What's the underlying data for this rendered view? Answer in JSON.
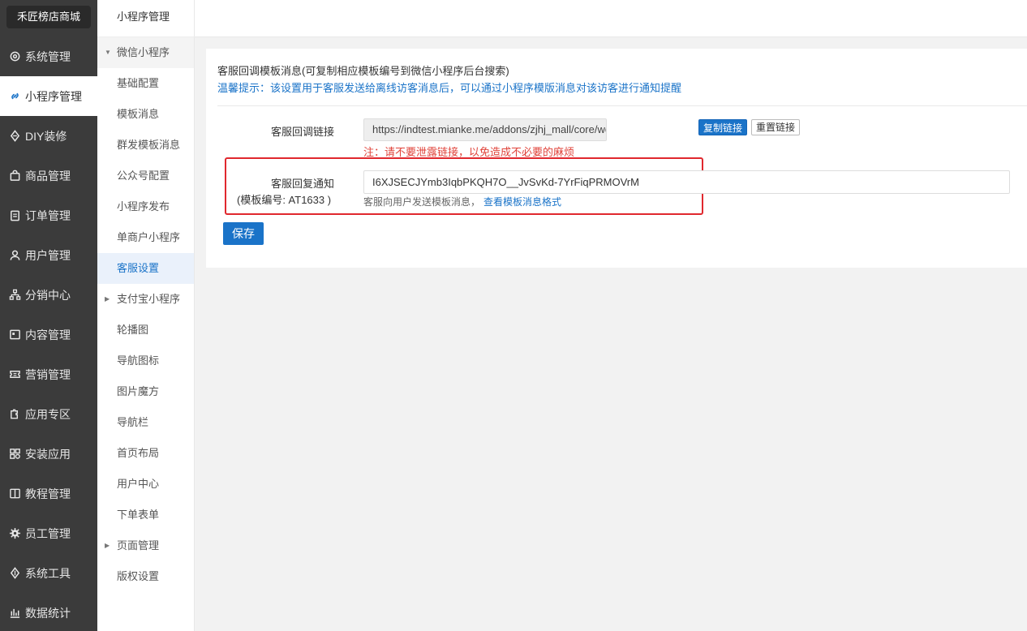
{
  "brand": "禾匠榜店商城",
  "sidebar": {
    "items": [
      {
        "label": "系统管理",
        "icon": "gear-icon"
      },
      {
        "label": "小程序管理",
        "icon": "link-icon",
        "active": true
      },
      {
        "label": "DIY装修",
        "icon": "diamond-icon"
      },
      {
        "label": "商品管理",
        "icon": "bag-icon"
      },
      {
        "label": "订单管理",
        "icon": "clipboard-icon"
      },
      {
        "label": "用户管理",
        "icon": "user-icon"
      },
      {
        "label": "分销中心",
        "icon": "tree-icon"
      },
      {
        "label": "内容管理",
        "icon": "document-icon"
      },
      {
        "label": "营销管理",
        "icon": "ticket-icon"
      },
      {
        "label": "应用专区",
        "icon": "puzzle-icon"
      },
      {
        "label": "安装应用",
        "icon": "grid-icon"
      },
      {
        "label": "教程管理",
        "icon": "book-icon"
      },
      {
        "label": "员工管理",
        "icon": "cog-icon"
      },
      {
        "label": "系统工具",
        "icon": "tool-icon"
      },
      {
        "label": "数据统计",
        "icon": "chart-icon"
      }
    ]
  },
  "subnav": {
    "title": "小程序管理",
    "items": [
      {
        "label": "微信小程序",
        "type": "group",
        "expanded": true
      },
      {
        "label": "基础配置"
      },
      {
        "label": "模板消息"
      },
      {
        "label": "群发模板消息"
      },
      {
        "label": "公众号配置"
      },
      {
        "label": "小程序发布"
      },
      {
        "label": "单商户小程序"
      },
      {
        "label": "客服设置",
        "active": true
      },
      {
        "label": "支付宝小程序",
        "type": "group",
        "expanded": false
      },
      {
        "label": "轮播图"
      },
      {
        "label": "导航图标"
      },
      {
        "label": "图片魔方"
      },
      {
        "label": "导航栏"
      },
      {
        "label": "首页布局"
      },
      {
        "label": "用户中心"
      },
      {
        "label": "下单表单"
      },
      {
        "label": "页面管理",
        "type": "group",
        "expanded": false
      },
      {
        "label": "版权设置"
      }
    ]
  },
  "main": {
    "title": "客服回调模板消息(可复制相应模板编号到微信小程序后台搜索)",
    "tip": "温馨提示：该设置用于客服发送给离线访客消息后，可以通过小程序模版消息对该访客进行通知提醒",
    "callback": {
      "label": "客服回调链接",
      "value": "https://indtest.mianke.me/addons/zjhj_mall/core/web/index.php",
      "warning": "注：请不要泄露链接，以免造成不必要的麻烦",
      "copy_label": "复制链接",
      "reset_label": "重置链接"
    },
    "reply": {
      "label": "客服回复通知",
      "sublabel": "(模板编号: AT1633 )",
      "value": "I6XJSECJYmb3IqbPKQH7O__JvSvKd-7YrFiqPRMOVrM",
      "hint": "客服向用户发送模板消息，",
      "hint_link": "查看模板消息格式"
    },
    "save_label": "保存"
  }
}
